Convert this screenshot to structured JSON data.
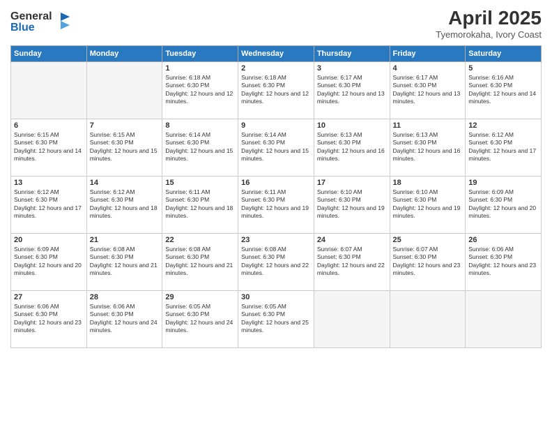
{
  "logo": {
    "line1": "General",
    "line2": "Blue"
  },
  "title": "April 2025",
  "subtitle": "Tyemorokaha, Ivory Coast",
  "weekdays": [
    "Sunday",
    "Monday",
    "Tuesday",
    "Wednesday",
    "Thursday",
    "Friday",
    "Saturday"
  ],
  "weeks": [
    [
      {
        "day": "",
        "info": ""
      },
      {
        "day": "",
        "info": ""
      },
      {
        "day": "1",
        "info": "Sunrise: 6:18 AM\nSunset: 6:30 PM\nDaylight: 12 hours and 12 minutes."
      },
      {
        "day": "2",
        "info": "Sunrise: 6:18 AM\nSunset: 6:30 PM\nDaylight: 12 hours and 12 minutes."
      },
      {
        "day": "3",
        "info": "Sunrise: 6:17 AM\nSunset: 6:30 PM\nDaylight: 12 hours and 13 minutes."
      },
      {
        "day": "4",
        "info": "Sunrise: 6:17 AM\nSunset: 6:30 PM\nDaylight: 12 hours and 13 minutes."
      },
      {
        "day": "5",
        "info": "Sunrise: 6:16 AM\nSunset: 6:30 PM\nDaylight: 12 hours and 14 minutes."
      }
    ],
    [
      {
        "day": "6",
        "info": "Sunrise: 6:15 AM\nSunset: 6:30 PM\nDaylight: 12 hours and 14 minutes."
      },
      {
        "day": "7",
        "info": "Sunrise: 6:15 AM\nSunset: 6:30 PM\nDaylight: 12 hours and 15 minutes."
      },
      {
        "day": "8",
        "info": "Sunrise: 6:14 AM\nSunset: 6:30 PM\nDaylight: 12 hours and 15 minutes."
      },
      {
        "day": "9",
        "info": "Sunrise: 6:14 AM\nSunset: 6:30 PM\nDaylight: 12 hours and 15 minutes."
      },
      {
        "day": "10",
        "info": "Sunrise: 6:13 AM\nSunset: 6:30 PM\nDaylight: 12 hours and 16 minutes."
      },
      {
        "day": "11",
        "info": "Sunrise: 6:13 AM\nSunset: 6:30 PM\nDaylight: 12 hours and 16 minutes."
      },
      {
        "day": "12",
        "info": "Sunrise: 6:12 AM\nSunset: 6:30 PM\nDaylight: 12 hours and 17 minutes."
      }
    ],
    [
      {
        "day": "13",
        "info": "Sunrise: 6:12 AM\nSunset: 6:30 PM\nDaylight: 12 hours and 17 minutes."
      },
      {
        "day": "14",
        "info": "Sunrise: 6:12 AM\nSunset: 6:30 PM\nDaylight: 12 hours and 18 minutes."
      },
      {
        "day": "15",
        "info": "Sunrise: 6:11 AM\nSunset: 6:30 PM\nDaylight: 12 hours and 18 minutes."
      },
      {
        "day": "16",
        "info": "Sunrise: 6:11 AM\nSunset: 6:30 PM\nDaylight: 12 hours and 19 minutes."
      },
      {
        "day": "17",
        "info": "Sunrise: 6:10 AM\nSunset: 6:30 PM\nDaylight: 12 hours and 19 minutes."
      },
      {
        "day": "18",
        "info": "Sunrise: 6:10 AM\nSunset: 6:30 PM\nDaylight: 12 hours and 19 minutes."
      },
      {
        "day": "19",
        "info": "Sunrise: 6:09 AM\nSunset: 6:30 PM\nDaylight: 12 hours and 20 minutes."
      }
    ],
    [
      {
        "day": "20",
        "info": "Sunrise: 6:09 AM\nSunset: 6:30 PM\nDaylight: 12 hours and 20 minutes."
      },
      {
        "day": "21",
        "info": "Sunrise: 6:08 AM\nSunset: 6:30 PM\nDaylight: 12 hours and 21 minutes."
      },
      {
        "day": "22",
        "info": "Sunrise: 6:08 AM\nSunset: 6:30 PM\nDaylight: 12 hours and 21 minutes."
      },
      {
        "day": "23",
        "info": "Sunrise: 6:08 AM\nSunset: 6:30 PM\nDaylight: 12 hours and 22 minutes."
      },
      {
        "day": "24",
        "info": "Sunrise: 6:07 AM\nSunset: 6:30 PM\nDaylight: 12 hours and 22 minutes."
      },
      {
        "day": "25",
        "info": "Sunrise: 6:07 AM\nSunset: 6:30 PM\nDaylight: 12 hours and 23 minutes."
      },
      {
        "day": "26",
        "info": "Sunrise: 6:06 AM\nSunset: 6:30 PM\nDaylight: 12 hours and 23 minutes."
      }
    ],
    [
      {
        "day": "27",
        "info": "Sunrise: 6:06 AM\nSunset: 6:30 PM\nDaylight: 12 hours and 23 minutes."
      },
      {
        "day": "28",
        "info": "Sunrise: 6:06 AM\nSunset: 6:30 PM\nDaylight: 12 hours and 24 minutes."
      },
      {
        "day": "29",
        "info": "Sunrise: 6:05 AM\nSunset: 6:30 PM\nDaylight: 12 hours and 24 minutes."
      },
      {
        "day": "30",
        "info": "Sunrise: 6:05 AM\nSunset: 6:30 PM\nDaylight: 12 hours and 25 minutes."
      },
      {
        "day": "",
        "info": ""
      },
      {
        "day": "",
        "info": ""
      },
      {
        "day": "",
        "info": ""
      }
    ]
  ]
}
